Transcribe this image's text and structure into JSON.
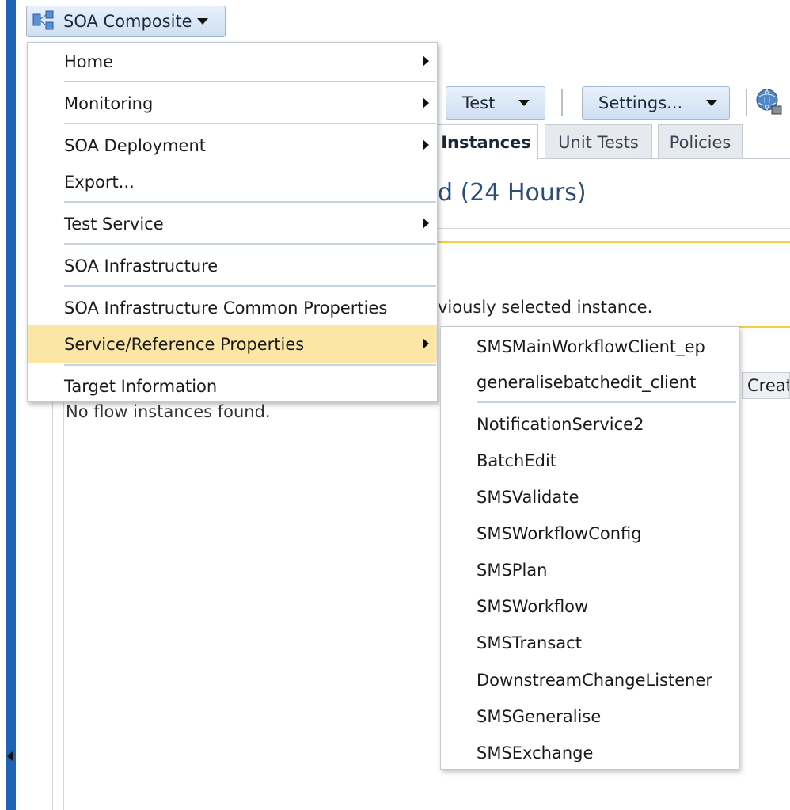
{
  "composite": {
    "label": "SOA Composite",
    "icon": "composite-icon"
  },
  "toolbar": {
    "test_label": "Test",
    "settings_label": "Settings..."
  },
  "tabs": [
    "Instances",
    "Unit Tests",
    "Policies"
  ],
  "page": {
    "heading_partial": "d (24 Hours)",
    "info_partial": "viously selected instance.",
    "column_partial": "Creat",
    "empty_message": "No flow instances found."
  },
  "menu": {
    "items": [
      {
        "label": "Home",
        "submenu": true
      },
      {
        "label": "Monitoring",
        "submenu": true
      },
      {
        "label": "SOA Deployment",
        "submenu": true
      },
      {
        "label": "Export...",
        "submenu": false
      },
      {
        "label": "Test Service",
        "submenu": true
      },
      {
        "label": "SOA Infrastructure",
        "submenu": false
      },
      {
        "label": "SOA Infrastructure Common Properties",
        "submenu": false
      },
      {
        "label": "Service/Reference Properties",
        "submenu": true,
        "highlighted": true
      },
      {
        "label": "Target Information",
        "submenu": false
      }
    ]
  },
  "submenu": {
    "items": [
      "SMSMainWorkflowClient_ep",
      "generalisebatchedit_client",
      "NotificationService2",
      "BatchEdit",
      "SMSValidate",
      "SMSWorkflowConfig",
      "SMSPlan",
      "SMSWorkflow",
      "SMSTransact",
      "DownstreamChangeListener",
      "SMSGeneralise",
      "SMSExchange"
    ]
  },
  "colors": {
    "highlight": "#fbe6a5",
    "accent": "#1f63b5",
    "tab_active": "#ffffff"
  }
}
